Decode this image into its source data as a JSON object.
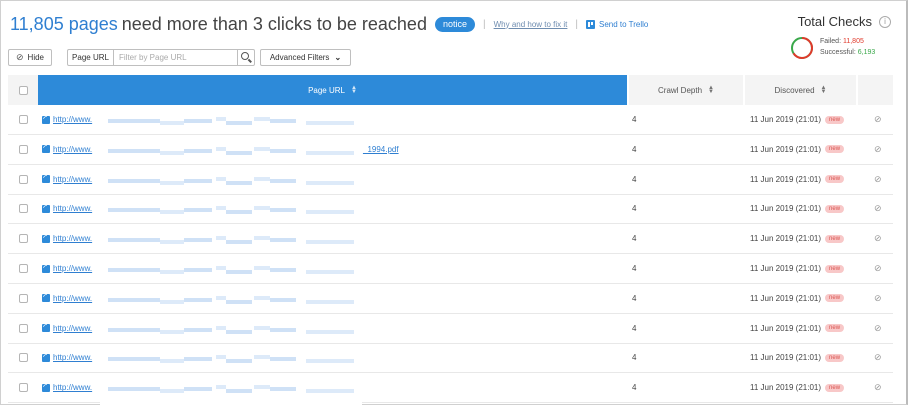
{
  "header": {
    "count": "11,805 pages",
    "rest": "need more than 3 clicks to be reached",
    "badge": "notice",
    "why_link": "Why and how to fix it",
    "trello_label": "Send to Trello",
    "separator": "|"
  },
  "total_checks": {
    "title": "Total Checks",
    "info_glyph": "i",
    "failed_label": "Failed:",
    "failed_value": "11,805",
    "successful_label": "Successful:",
    "successful_value": "6,193",
    "failed_color": "#e0392b",
    "successful_color": "#3aa84a",
    "failed_share": 0.656
  },
  "toolbar": {
    "hide_label": "Hide",
    "hide_icon": "eye-off-icon",
    "filter_select": "Page URL",
    "filter_placeholder": "Filter by Page URL",
    "advanced_label": "Advanced Filters"
  },
  "table": {
    "columns": {
      "url": "Page URL",
      "depth": "Crawl Depth",
      "discovered": "Discovered"
    },
    "rows": [
      {
        "url": "http://www.",
        "suffix": "",
        "depth": "4",
        "discovered": "11 Jun 2019 (21:01)",
        "badge": "new"
      },
      {
        "url": "http://www.",
        "suffix": "_1994.pdf",
        "depth": "4",
        "discovered": "11 Jun 2019 (21:01)",
        "badge": "new"
      },
      {
        "url": "http://www.",
        "suffix": "",
        "depth": "4",
        "discovered": "11 Jun 2019 (21:01)",
        "badge": "new"
      },
      {
        "url": "http://www.",
        "suffix": "",
        "depth": "4",
        "discovered": "11 Jun 2019 (21:01)",
        "badge": "new"
      },
      {
        "url": "http://www.",
        "suffix": "",
        "depth": "4",
        "discovered": "11 Jun 2019 (21:01)",
        "badge": "new"
      },
      {
        "url": "http://www.",
        "suffix": "",
        "depth": "4",
        "discovered": "11 Jun 2019 (21:01)",
        "badge": "new"
      },
      {
        "url": "http://www.",
        "suffix": "",
        "depth": "4",
        "discovered": "11 Jun 2019 (21:01)",
        "badge": "new"
      },
      {
        "url": "http://www.",
        "suffix": "",
        "depth": "4",
        "discovered": "11 Jun 2019 (21:01)",
        "badge": "new"
      },
      {
        "url": "http://www.",
        "suffix": "",
        "depth": "4",
        "discovered": "11 Jun 2019 (21:01)",
        "badge": "new"
      },
      {
        "url": "http://www.",
        "suffix": "",
        "depth": "4",
        "discovered": "11 Jun 2019 (21:01)",
        "badge": "new"
      }
    ],
    "row_icons": {
      "link": "external-link-icon",
      "action": "eye-off-icon"
    }
  },
  "colors": {
    "accent": "#2d8ad9",
    "link": "#2f7fd1",
    "new_badge_bg": "#f8c8c8",
    "new_badge_text": "#d9534f"
  }
}
